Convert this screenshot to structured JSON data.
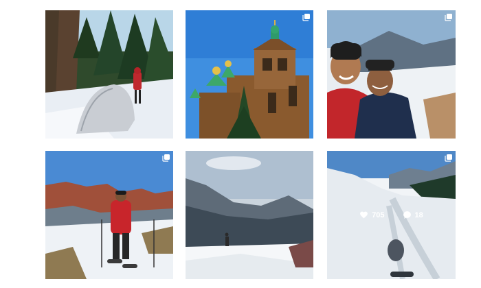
{
  "grid": {
    "posts": [
      {
        "scene": "tent-in-snowy-forest",
        "multi": false
      },
      {
        "scene": "wooden-church-green-domes",
        "multi": true
      },
      {
        "scene": "selfie-two-men-mountains",
        "multi": true
      },
      {
        "scene": "hiker-snowshoes-red-cliffs",
        "multi": true
      },
      {
        "scene": "misty-mountain-valley",
        "multi": false
      },
      {
        "scene": "snowshoe-tracks-valley",
        "multi": true,
        "hover": true,
        "likes": "705",
        "comments": "18"
      }
    ]
  },
  "icons": {
    "multi": "multiple-photos-icon",
    "likes": "heart-icon",
    "comments": "comment-bubble-icon"
  },
  "colors": {
    "background": "#ffffff",
    "overlay_text": "#ffffff"
  }
}
